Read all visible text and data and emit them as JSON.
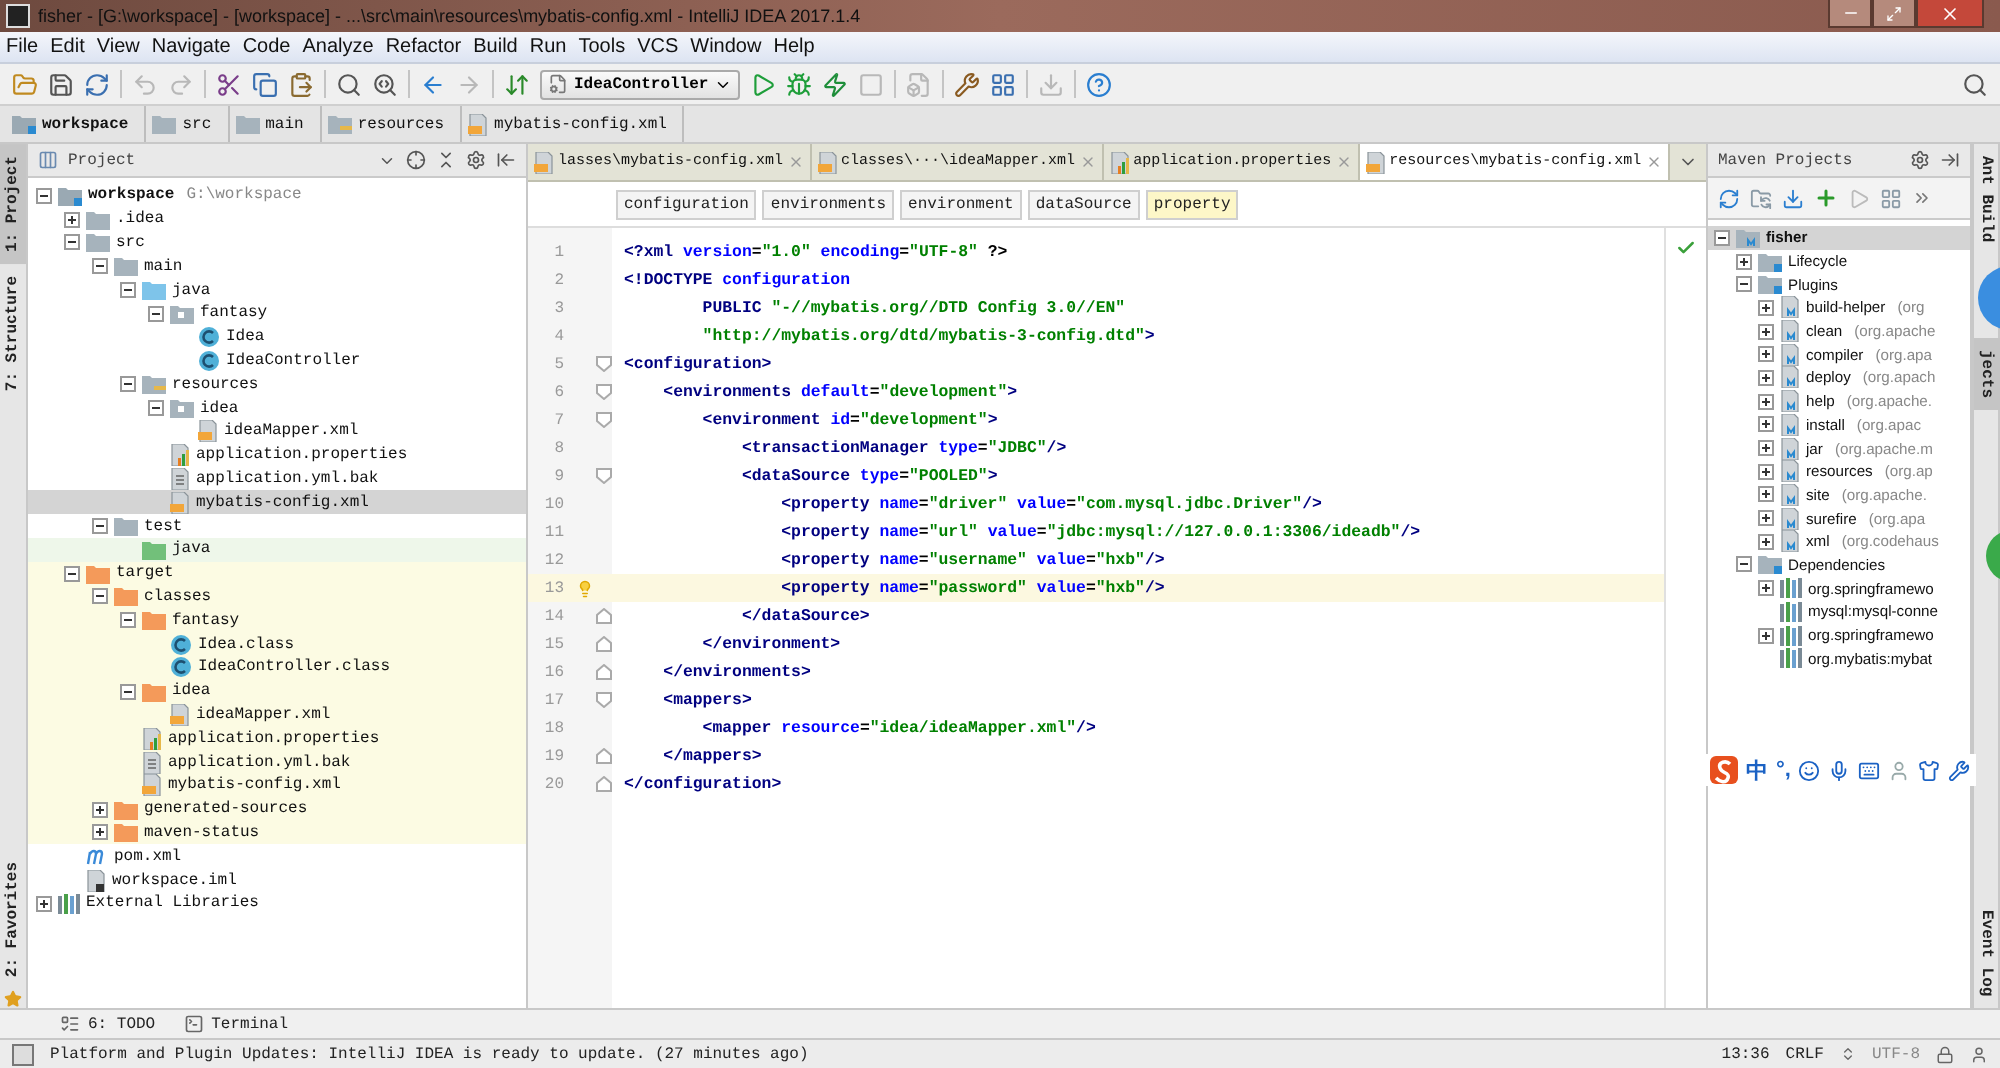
{
  "window": {
    "title": "fisher - [G:\\workspace] - [workspace] - ...\\src\\main\\resources\\mybatis-config.xml - IntelliJ IDEA 2017.1.4"
  },
  "menu": [
    "File",
    "Edit",
    "View",
    "Navigate",
    "Code",
    "Analyze",
    "Refactor",
    "Build",
    "Run",
    "Tools",
    "VCS",
    "Window",
    "Help"
  ],
  "toolbar": [
    {
      "kind": "open",
      "disabled": false
    },
    {
      "kind": "save",
      "disabled": false
    },
    {
      "kind": "sync",
      "disabled": false
    },
    {
      "kind": "separator"
    },
    {
      "kind": "undo",
      "disabled": true
    },
    {
      "kind": "redo",
      "disabled": true
    },
    {
      "kind": "separator"
    },
    {
      "kind": "cut",
      "disabled": false
    },
    {
      "kind": "copy",
      "disabled": false
    },
    {
      "kind": "paste",
      "disabled": false
    },
    {
      "kind": "separator"
    },
    {
      "kind": "find",
      "disabled": false
    },
    {
      "kind": "find-usages",
      "disabled": false
    },
    {
      "kind": "separator"
    },
    {
      "kind": "back",
      "disabled": false
    },
    {
      "kind": "forward",
      "disabled": true
    },
    {
      "kind": "separator"
    },
    {
      "kind": "build",
      "disabled": false
    },
    {
      "kind": "run-config",
      "label": "IdeaController",
      "disabled": false
    },
    {
      "kind": "run",
      "disabled": false
    },
    {
      "kind": "debug",
      "disabled": false
    },
    {
      "kind": "coverage",
      "disabled": false
    },
    {
      "kind": "stop",
      "disabled": true
    },
    {
      "kind": "separator"
    },
    {
      "kind": "sdk",
      "disabled": true
    },
    {
      "kind": "separator"
    },
    {
      "kind": "settings",
      "disabled": false
    },
    {
      "kind": "structure",
      "disabled": false
    },
    {
      "kind": "separator"
    },
    {
      "kind": "vcs",
      "disabled": true
    },
    {
      "kind": "separator"
    },
    {
      "kind": "help",
      "disabled": false
    }
  ],
  "breadcrumbs": [
    {
      "label": "workspace",
      "kind": "module"
    },
    {
      "label": "src",
      "kind": "folder"
    },
    {
      "label": "main",
      "kind": "folder"
    },
    {
      "label": "resources",
      "kind": "resource-folder"
    },
    {
      "label": "mybatis-config.xml",
      "kind": "xml"
    }
  ],
  "left_strip": [
    {
      "label": "1: Project",
      "selected": true
    },
    {
      "label": "7: Structure",
      "selected": false
    }
  ],
  "left_strip_bottom": [
    {
      "label": "2: Favorites",
      "selected": false
    }
  ],
  "project_panel": {
    "title": "Project",
    "items": [
      {
        "label": "workspace",
        "hint": "G:\\workspace",
        "kind": "module",
        "expanded": true,
        "selected": false,
        "children": [
          {
            "label": ".idea",
            "kind": "folder",
            "expanded": false,
            "selected": false
          },
          {
            "label": "src",
            "kind": "folder",
            "expanded": true,
            "selected": false,
            "children": [
              {
                "label": "main",
                "kind": "folder",
                "expanded": true,
                "selected": false,
                "children": [
                  {
                    "label": "java",
                    "kind": "source-folder",
                    "expanded": true,
                    "selected": false,
                    "children": [
                      {
                        "label": "fantasy",
                        "kind": "package",
                        "expanded": true,
                        "selected": false,
                        "children": [
                          {
                            "label": "Idea",
                            "kind": "class",
                            "selected": false
                          },
                          {
                            "label": "IdeaController",
                            "kind": "class",
                            "selected": false
                          }
                        ]
                      }
                    ]
                  },
                  {
                    "label": "resources",
                    "kind": "resource-folder",
                    "expanded": true,
                    "selected": false,
                    "children": [
                      {
                        "label": "idea",
                        "kind": "package",
                        "expanded": true,
                        "selected": false,
                        "children": [
                          {
                            "label": "ideaMapper.xml",
                            "kind": "xml",
                            "selected": false
                          }
                        ]
                      },
                      {
                        "label": "application.properties",
                        "kind": "properties",
                        "selected": false
                      },
                      {
                        "label": "application.yml.bak",
                        "kind": "text-file",
                        "selected": false
                      },
                      {
                        "label": "mybatis-config.xml",
                        "kind": "xml",
                        "selected": true
                      }
                    ]
                  }
                ]
              },
              {
                "label": "test",
                "kind": "folder",
                "expanded": true,
                "selected": false,
                "children": [
                  {
                    "label": "java",
                    "kind": "test-folder",
                    "selected": false
                  }
                ]
              }
            ]
          },
          {
            "label": "target",
            "kind": "excluded-folder",
            "expanded": true,
            "selected": false,
            "children": [
              {
                "label": "classes",
                "kind": "excluded-folder",
                "expanded": true,
                "selected": false,
                "children": [
                  {
                    "label": "fantasy",
                    "kind": "excluded-folder",
                    "expanded": true,
                    "selected": false,
                    "children": [
                      {
                        "label": "Idea.class",
                        "kind": "compiled-class",
                        "selected": false
                      },
                      {
                        "label": "IdeaController.class",
                        "kind": "compiled-class",
                        "selected": false
                      }
                    ]
                  },
                  {
                    "label": "idea",
                    "kind": "excluded-folder",
                    "expanded": true,
                    "selected": false,
                    "children": [
                      {
                        "label": "ideaMapper.xml",
                        "kind": "xml",
                        "selected": false
                      }
                    ]
                  },
                  {
                    "label": "application.properties",
                    "kind": "properties",
                    "selected": false
                  },
                  {
                    "label": "application.yml.bak",
                    "kind": "text-file",
                    "selected": false
                  },
                  {
                    "label": "mybatis-config.xml",
                    "kind": "xml",
                    "selected": false
                  }
                ]
              },
              {
                "label": "generated-sources",
                "kind": "excluded-folder",
                "expanded": false,
                "selected": false
              },
              {
                "label": "maven-status",
                "kind": "excluded-folder",
                "expanded": false,
                "selected": false
              }
            ]
          },
          {
            "label": "pom.xml",
            "kind": "maven",
            "selected": false
          },
          {
            "label": "workspace.iml",
            "kind": "iml",
            "selected": false
          }
        ]
      },
      {
        "label": "External Libraries",
        "kind": "libraries",
        "expanded": false,
        "selected": false
      }
    ]
  },
  "editor": {
    "tabs": [
      {
        "label": "lasses\\mybatis-config.xml",
        "kind": "xml",
        "selected": false
      },
      {
        "label": "classes\\···\\ideaMapper.xml",
        "kind": "xml",
        "selected": false
      },
      {
        "label": "application.properties",
        "kind": "properties",
        "selected": false
      },
      {
        "label": "resources\\mybatis-config.xml",
        "kind": "xml",
        "selected": true
      }
    ],
    "tag_path": [
      {
        "label": "configuration",
        "selected": false
      },
      {
        "label": "environments",
        "selected": false
      },
      {
        "label": "environment",
        "selected": false
      },
      {
        "label": "dataSource",
        "selected": false
      },
      {
        "label": "property",
        "selected": true
      }
    ],
    "lines": [
      {
        "number": "1",
        "current": false,
        "tokens": [
          {
            "kind": "tag",
            "text": "<?xml "
          },
          {
            "kind": "attr",
            "text": "version"
          },
          {
            "kind": "plain",
            "text": "="
          },
          {
            "kind": "value",
            "text": "\"1.0\""
          },
          {
            "kind": "attr",
            "text": " encoding"
          },
          {
            "kind": "plain",
            "text": "="
          },
          {
            "kind": "value",
            "text": "\"UTF-8\""
          },
          {
            "kind": "plain",
            "text": " ?>"
          }
        ]
      },
      {
        "number": "2",
        "current": false,
        "tokens": [
          {
            "kind": "tag",
            "text": "<!DOCTYPE "
          },
          {
            "kind": "attr",
            "text": "configuration"
          }
        ]
      },
      {
        "number": "3",
        "current": false,
        "tokens": [
          {
            "kind": "tag",
            "text": "        PUBLIC "
          },
          {
            "kind": "value",
            "text": "\"-//mybatis.org//DTD Config 3.0//EN\""
          }
        ]
      },
      {
        "number": "4",
        "current": false,
        "tokens": [
          {
            "kind": "value",
            "text": "        \"http://mybatis.org/dtd/mybatis-3-config.dtd\""
          },
          {
            "kind": "tag",
            "text": ">"
          }
        ]
      },
      {
        "number": "5",
        "current": false,
        "fold_start": true,
        "tokens": [
          {
            "kind": "tag",
            "text": "<configuration>"
          }
        ]
      },
      {
        "number": "6",
        "current": false,
        "fold_start": true,
        "tokens": [
          {
            "kind": "tag",
            "text": "    <environments "
          },
          {
            "kind": "attr",
            "text": "default"
          },
          {
            "kind": "plain",
            "text": "="
          },
          {
            "kind": "value",
            "text": "\"development\""
          },
          {
            "kind": "tag",
            "text": ">"
          }
        ]
      },
      {
        "number": "7",
        "current": false,
        "fold_start": true,
        "tokens": [
          {
            "kind": "tag",
            "text": "        <environment "
          },
          {
            "kind": "attr",
            "text": "id"
          },
          {
            "kind": "plain",
            "text": "="
          },
          {
            "kind": "value",
            "text": "\"development\""
          },
          {
            "kind": "tag",
            "text": ">"
          }
        ]
      },
      {
        "number": "8",
        "current": false,
        "tokens": [
          {
            "kind": "tag",
            "text": "            <transactionManager "
          },
          {
            "kind": "attr",
            "text": "type"
          },
          {
            "kind": "plain",
            "text": "="
          },
          {
            "kind": "value",
            "text": "\"JDBC\""
          },
          {
            "kind": "tag",
            "text": "/>"
          }
        ]
      },
      {
        "number": "9",
        "current": false,
        "fold_start": true,
        "tokens": [
          {
            "kind": "tag",
            "text": "            <dataSource "
          },
          {
            "kind": "attr",
            "text": "type"
          },
          {
            "kind": "plain",
            "text": "="
          },
          {
            "kind": "value",
            "text": "\"POOLED\""
          },
          {
            "kind": "tag",
            "text": ">"
          }
        ]
      },
      {
        "number": "10",
        "current": false,
        "tokens": [
          {
            "kind": "tag",
            "text": "                <property "
          },
          {
            "kind": "attr",
            "text": "name"
          },
          {
            "kind": "plain",
            "text": "="
          },
          {
            "kind": "value",
            "text": "\"driver\""
          },
          {
            "kind": "attr",
            "text": " value"
          },
          {
            "kind": "plain",
            "text": "="
          },
          {
            "kind": "value",
            "text": "\"com.mysql.jdbc.Driver\""
          },
          {
            "kind": "tag",
            "text": "/>"
          }
        ]
      },
      {
        "number": "11",
        "current": false,
        "tokens": [
          {
            "kind": "tag",
            "text": "                <property "
          },
          {
            "kind": "attr",
            "text": "name"
          },
          {
            "kind": "plain",
            "text": "="
          },
          {
            "kind": "value",
            "text": "\"url\""
          },
          {
            "kind": "attr",
            "text": " value"
          },
          {
            "kind": "plain",
            "text": "="
          },
          {
            "kind": "value",
            "text": "\"jdbc:mysql://127.0.0.1:3306/ideadb\""
          },
          {
            "kind": "tag",
            "text": "/>"
          }
        ]
      },
      {
        "number": "12",
        "current": false,
        "tokens": [
          {
            "kind": "tag",
            "text": "                <property "
          },
          {
            "kind": "attr",
            "text": "name"
          },
          {
            "kind": "plain",
            "text": "="
          },
          {
            "kind": "value",
            "text": "\"username\""
          },
          {
            "kind": "attr",
            "text": " value"
          },
          {
            "kind": "plain",
            "text": "="
          },
          {
            "kind": "value",
            "text": "\"hxb\""
          },
          {
            "kind": "tag",
            "text": "/>"
          }
        ]
      },
      {
        "number": "13",
        "current": true,
        "tokens": [
          {
            "kind": "tag",
            "text": "                <property "
          },
          {
            "kind": "attr",
            "text": "name"
          },
          {
            "kind": "plain",
            "text": "="
          },
          {
            "kind": "value",
            "text": "\"password\""
          },
          {
            "kind": "attr",
            "text": " value"
          },
          {
            "kind": "plain",
            "text": "="
          },
          {
            "kind": "value",
            "text": "\"hxb\""
          },
          {
            "kind": "tag",
            "text": "/>"
          }
        ]
      },
      {
        "number": "14",
        "current": false,
        "fold_end": true,
        "tokens": [
          {
            "kind": "tag",
            "text": "            </dataSource>"
          }
        ]
      },
      {
        "number": "15",
        "current": false,
        "fold_end": true,
        "tokens": [
          {
            "kind": "tag",
            "text": "        </environment>"
          }
        ]
      },
      {
        "number": "16",
        "current": false,
        "fold_end": true,
        "tokens": [
          {
            "kind": "tag",
            "text": "    </environments>"
          }
        ]
      },
      {
        "number": "17",
        "current": false,
        "fold_start": true,
        "tokens": [
          {
            "kind": "tag",
            "text": "    <mappers>"
          }
        ]
      },
      {
        "number": "18",
        "current": false,
        "tokens": [
          {
            "kind": "tag",
            "text": "        <mapper "
          },
          {
            "kind": "attr",
            "text": "resource"
          },
          {
            "kind": "plain",
            "text": "="
          },
          {
            "kind": "value",
            "text": "\"idea/ideaMapper.xml\""
          },
          {
            "kind": "tag",
            "text": "/>"
          }
        ]
      },
      {
        "number": "19",
        "current": false,
        "fold_end": true,
        "tokens": [
          {
            "kind": "tag",
            "text": "    </mappers>"
          }
        ]
      },
      {
        "number": "20",
        "current": false,
        "fold_end": true,
        "tokens": [
          {
            "kind": "tag",
            "text": "</configuration>"
          }
        ]
      }
    ]
  },
  "maven_panel": {
    "title": "Maven Projects",
    "items": [
      {
        "label": "fisher",
        "kind": "project",
        "expanded": true,
        "selected": true,
        "children": [
          {
            "label": "Lifecycle",
            "kind": "group",
            "expanded": false,
            "selected": false
          },
          {
            "label": "Plugins",
            "kind": "group",
            "expanded": true,
            "selected": false,
            "children": [
              {
                "label": "build-helper",
                "hint": "(org",
                "kind": "plugin",
                "expanded": false,
                "selected": false
              },
              {
                "label": "clean",
                "hint": "(org.apache",
                "kind": "plugin",
                "expanded": false,
                "selected": false
              },
              {
                "label": "compiler",
                "hint": "(org.apa",
                "kind": "plugin",
                "expanded": false,
                "selected": false
              },
              {
                "label": "deploy",
                "hint": "(org.apach",
                "kind": "plugin",
                "expanded": false,
                "selected": false
              },
              {
                "label": "help",
                "hint": "(org.apache.",
                "kind": "plugin",
                "expanded": false,
                "selected": false
              },
              {
                "label": "install",
                "hint": "(org.apac",
                "kind": "plugin",
                "expanded": false,
                "selected": false
              },
              {
                "label": "jar",
                "hint": "(org.apache.m",
                "kind": "plugin",
                "expanded": false,
                "selected": false
              },
              {
                "label": "resources",
                "hint": "(org.ap",
                "kind": "plugin",
                "expanded": false,
                "selected": false
              },
              {
                "label": "site",
                "hint": "(org.apache.",
                "kind": "plugin",
                "expanded": false,
                "selected": false
              },
              {
                "label": "surefire",
                "hint": "(org.apa",
                "kind": "plugin",
                "expanded": false,
                "selected": false
              },
              {
                "label": "xml",
                "hint": "(org.codehaus",
                "kind": "plugin",
                "expanded": false,
                "selected": false
              }
            ]
          },
          {
            "label": "Dependencies",
            "kind": "group",
            "expanded": true,
            "selected": false,
            "children": [
              {
                "label": "org.springframewo",
                "kind": "dependency",
                "expanded": false,
                "selected": false
              },
              {
                "label": "mysql:mysql-conne",
                "kind": "dependency",
                "selected": false
              },
              {
                "label": "org.springframewo",
                "kind": "dependency",
                "expanded": false,
                "selected": false
              },
              {
                "label": "org.mybatis:mybat",
                "kind": "dependency",
                "selected": false
              }
            ]
          }
        ]
      }
    ]
  },
  "right_strip": [
    {
      "label": "Ant Build",
      "selected": false
    },
    {
      "label": "jects",
      "selected": true
    }
  ],
  "right_strip_bottom": [
    {
      "label": "Event Log",
      "selected": false
    }
  ],
  "ime_bar": {
    "mode": "中",
    "punctuation": "°,"
  },
  "bottom_tools": [
    {
      "label": "6: TODO",
      "kind": "todo"
    },
    {
      "label": "Terminal",
      "kind": "terminal"
    }
  ],
  "status_bar": {
    "message": "Platform and Plugin Updates: IntelliJ IDEA is ready to update. (27 minutes ago)",
    "position": "13:36",
    "line_separator": "CRLF",
    "encoding": "UTF-8"
  }
}
